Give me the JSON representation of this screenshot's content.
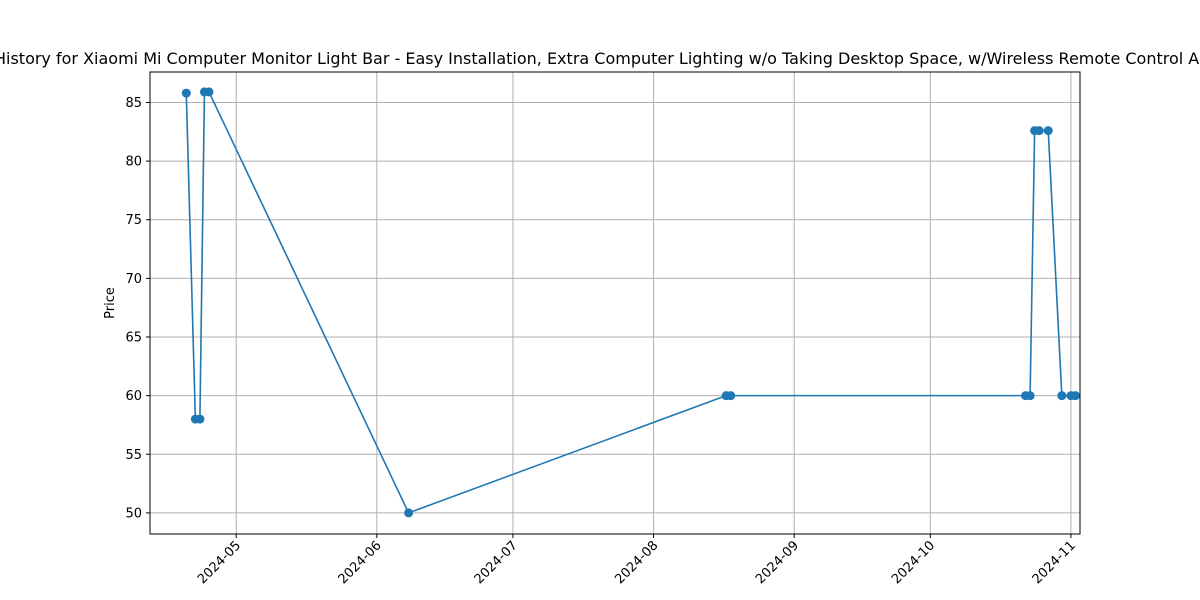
{
  "chart_data": {
    "type": "line",
    "title": "Price History for Xiaomi Mi Computer Monitor Light Bar - Easy Installation, Extra Computer Lighting w/o Taking Desktop Space, w/Wireless Remote Control Adjustment",
    "xlabel": "",
    "ylabel": "Price",
    "x_axis_type": "date",
    "xlim": [
      "2024-04-12",
      "2024-11-03"
    ],
    "ylim": [
      48.2,
      87.6
    ],
    "xticks": [
      "2024-05",
      "2024-06",
      "2024-07",
      "2024-08",
      "2024-09",
      "2024-10",
      "2024-11"
    ],
    "yticks": [
      50,
      55,
      60,
      65,
      70,
      75,
      80,
      85
    ],
    "grid": true,
    "marker": "circle",
    "color": "#1f77b4",
    "series": [
      {
        "x": [
          "2024-04-20",
          "2024-04-22",
          "2024-04-23",
          "2024-04-24",
          "2024-04-25",
          "2024-06-08",
          "2024-08-17",
          "2024-08-18",
          "2024-10-22",
          "2024-10-23",
          "2024-10-24",
          "2024-10-25",
          "2024-10-27",
          "2024-10-30",
          "2024-11-01",
          "2024-11-02"
        ],
        "values": [
          85.8,
          58.0,
          58.0,
          85.9,
          85.9,
          50.0,
          60.0,
          60.0,
          60.0,
          60.0,
          82.6,
          82.6,
          82.6,
          60.0,
          60.0,
          60.0
        ]
      }
    ]
  }
}
